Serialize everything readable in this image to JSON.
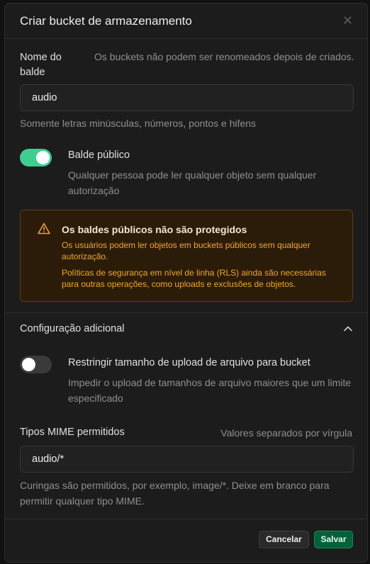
{
  "dialog": {
    "title": "Criar bucket de armazenamento",
    "close_glyph": "✕"
  },
  "bucket_name": {
    "label": "Nome do balde",
    "description": "Os buckets não podem ser renomeados depois de criados.",
    "value": "audio",
    "help": "Somente letras minúsculas, números, pontos e hifens"
  },
  "public_bucket": {
    "enabled": true,
    "label": "Balde público",
    "description": "Qualquer pessoa pode ler qualquer objeto sem qualquer autorização"
  },
  "warning": {
    "icon": "warning-triangle-icon",
    "title": "Os baldes públicos não são protegidos",
    "text1": "Os usuários podem ler objetos em buckets públicos sem qualquer autorização.",
    "text2": "Políticas de segurança em nível de linha (RLS) ainda são necessárias para outras operações, como uploads e exclusões de objetos."
  },
  "additional": {
    "title": "Configuração adicional",
    "expanded": true
  },
  "restrict_size": {
    "enabled": false,
    "label": "Restringir tamanho de upload de arquivo para bucket",
    "description": "Impedir o upload de tamanhos de arquivo maiores que um limite especificado"
  },
  "mime": {
    "label": "Tipos MIME permitidos",
    "hint": "Valores separados por vírgula",
    "value": "audio/*",
    "help": "Curingas são permitidos, por exemplo, image/*. Deixe em branco para permitir qualquer tipo MIME."
  },
  "footer": {
    "cancel_label": "Cancelar",
    "save_label": "Salvar"
  },
  "colors": {
    "accent_green": "#3ecf8e",
    "warning_orange": "#f5a623",
    "save_button": "#006239"
  }
}
